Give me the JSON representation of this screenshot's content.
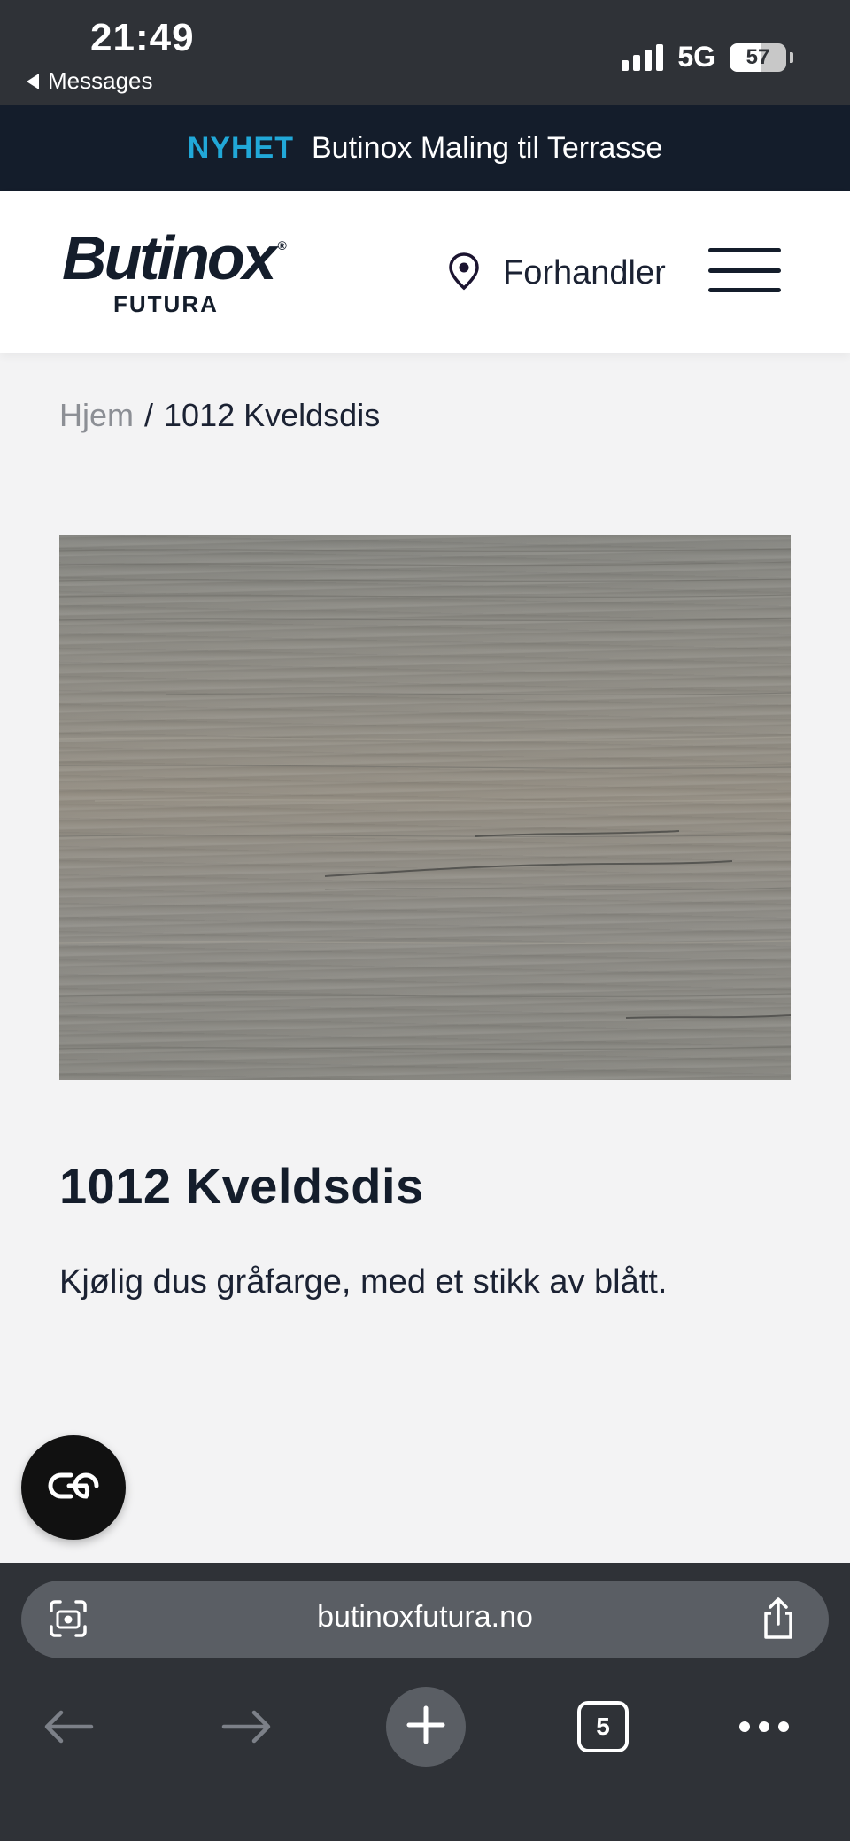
{
  "status_bar": {
    "time": "21:49",
    "back_label": "Messages",
    "network": "5G",
    "battery": "57"
  },
  "announcement": {
    "tag": "NYHET",
    "message": "Butinox Maling til Terrasse"
  },
  "header": {
    "logo_main": "Butinox",
    "logo_reg": "®",
    "logo_sub": "FUTURA",
    "dealer_label": "Forhandler",
    "dealer_icon": "location-pin-icon",
    "menu_icon": "hamburger-menu-icon"
  },
  "breadcrumb": {
    "home": "Hjem",
    "separator": "/",
    "current": "1012 Kveldsdis"
  },
  "product": {
    "swatch_color": "#8f8d85",
    "title": "1012 Kveldsdis",
    "description": "Kjølig dus gråfarge, med et stikk av blått."
  },
  "chat_button": {
    "icon": "chat-bubble-icon"
  },
  "browser": {
    "url": "butinoxfutura.no",
    "tab_count": "5",
    "icons": [
      "camera-scan-icon",
      "share-icon",
      "back-arrow-icon",
      "forward-arrow-icon",
      "plus-icon",
      "tabs-icon",
      "more-icon"
    ]
  }
}
